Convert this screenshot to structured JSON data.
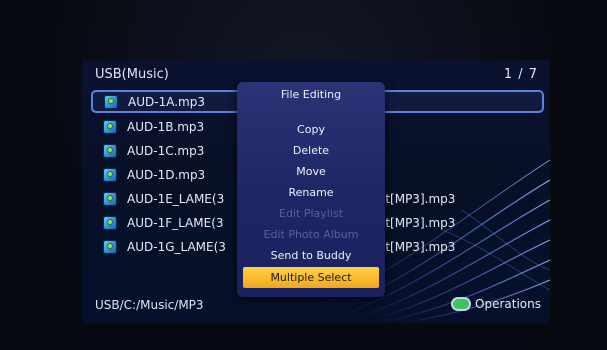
{
  "header": {
    "source_title": "USB(Music)",
    "page_indicator": "1 / 7"
  },
  "files": [
    {
      "name": "AUD-1A.mp3",
      "suffix": ""
    },
    {
      "name": "AUD-1B.mp3",
      "suffix": ""
    },
    {
      "name": "AUD-1C.mp3",
      "suffix": ""
    },
    {
      "name": "AUD-1D.mp3",
      "suffix": ""
    },
    {
      "name": "AUD-1E_LAME(3",
      "suffix": "it[MP3].mp3"
    },
    {
      "name": "AUD-1F_LAME(3",
      "suffix": "it[MP3].mp3"
    },
    {
      "name": "AUD-1G_LAME(3",
      "suffix": "it[MP3].mp3"
    }
  ],
  "popup": {
    "title": "File Editing",
    "items": [
      {
        "label": "Copy",
        "state": "enabled"
      },
      {
        "label": "Delete",
        "state": "enabled"
      },
      {
        "label": "Move",
        "state": "enabled"
      },
      {
        "label": "Rename",
        "state": "enabled"
      },
      {
        "label": "Edit Playlist",
        "state": "disabled"
      },
      {
        "label": "Edit Photo Album",
        "state": "disabled"
      },
      {
        "label": "Send to Buddy",
        "state": "enabled"
      },
      {
        "label": "Multiple Select",
        "state": "highlighted"
      }
    ]
  },
  "footer": {
    "path": "USB/C:/Music/MP3",
    "operations_label": "Operations"
  },
  "colors": {
    "highlight": "#f2a61a",
    "selection_border": "#5d84d8",
    "green_key": "#38c55a",
    "popup_bg": "#1e2766"
  }
}
